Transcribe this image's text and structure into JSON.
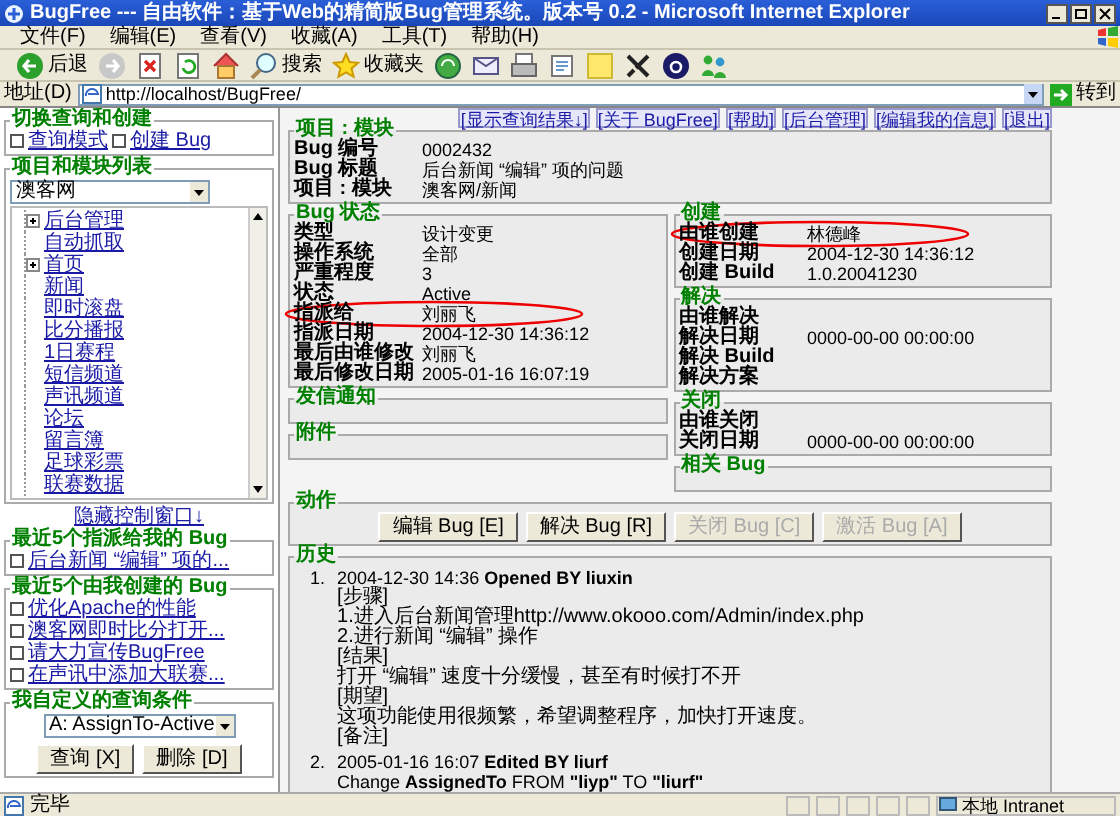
{
  "window": {
    "title": "BugFree --- 自由软件：基于Web的精简版Bug管理系统。版本号 0.2 - Microsoft Internet Explorer"
  },
  "menu": [
    "文件(F)",
    "编辑(E)",
    "查看(V)",
    "收藏(A)",
    "工具(T)",
    "帮助(H)"
  ],
  "toolbar": [
    {
      "kind": "back",
      "label": "后退"
    },
    {
      "kind": "forward"
    },
    {
      "kind": "stop"
    },
    {
      "kind": "refresh"
    },
    {
      "kind": "home"
    },
    {
      "kind": "search",
      "label": "搜索"
    },
    {
      "kind": "favorites",
      "label": "收藏夹"
    },
    {
      "kind": "media"
    },
    {
      "kind": "mail"
    },
    {
      "kind": "print"
    },
    {
      "kind": "edit"
    },
    {
      "kind": "note"
    },
    {
      "kind": "tool"
    },
    {
      "kind": "circle"
    },
    {
      "kind": "people"
    }
  ],
  "address": {
    "label": "地址(D)",
    "value": "http://localhost/BugFree/",
    "go": "转到"
  },
  "sidebar": {
    "switch": {
      "legend": "切换查询和创建",
      "options": [
        {
          "label": "查询模式",
          "checked": false
        },
        {
          "label": "创建 Bug",
          "checked": false
        }
      ]
    },
    "projects": {
      "legend": "项目和模块列表",
      "select": "澳客网",
      "items": [
        {
          "label": "后台管理",
          "has_children": true
        },
        {
          "label": "自动抓取",
          "has_children": false
        },
        {
          "label": "首页",
          "has_children": true
        },
        {
          "label": "新闻",
          "has_children": false
        },
        {
          "label": "即时滚盘",
          "has_children": false
        },
        {
          "label": "比分播报",
          "has_children": false
        },
        {
          "label": "1日赛程",
          "has_children": false
        },
        {
          "label": "短信频道",
          "has_children": false
        },
        {
          "label": "声讯频道",
          "has_children": false
        },
        {
          "label": "论坛",
          "has_children": false
        },
        {
          "label": "留言簿",
          "has_children": false
        },
        {
          "label": "足球彩票",
          "has_children": false
        },
        {
          "label": "联赛数据",
          "has_children": false
        }
      ]
    },
    "hide_link": "隐藏控制窗口↓",
    "assigned": {
      "legend": "最近5个指派给我的 Bug",
      "items": [
        {
          "label": "后台新闻 “编辑” 项的...",
          "checked": false
        }
      ]
    },
    "created": {
      "legend": "最近5个由我创建的 Bug",
      "items": [
        {
          "label": "优化Apache的性能",
          "checked": false
        },
        {
          "label": "澳客网即时比分打开...",
          "checked": false
        },
        {
          "label": "请大力宣传BugFree",
          "checked": false
        },
        {
          "label": "在声讯中添加大联赛...",
          "checked": false
        }
      ]
    },
    "queries": {
      "legend": "我自定义的查询条件",
      "select": "A: AssignTo-Active",
      "buttons": [
        "查询 [X]",
        "删除 [D]"
      ]
    }
  },
  "top_links": [
    "[显示查询结果↓]",
    "[关于 BugFree]",
    "[帮助]",
    "[后台管理]",
    "[编辑我的信息]",
    "[退出]"
  ],
  "bug": {
    "project": {
      "legend": "项目 : 模块",
      "fields": [
        {
          "label": "Bug 编号",
          "value": "0002432"
        },
        {
          "label": "Bug 标题",
          "value": "后台新闻 “编辑” 项的问题"
        },
        {
          "label": "项目 : 模块",
          "value": "澳客网/新闻"
        }
      ]
    },
    "status": {
      "legend": "Bug 状态",
      "fields": [
        {
          "label": "类型",
          "value": "设计变更"
        },
        {
          "label": "操作系统",
          "value": "全部"
        },
        {
          "label": "严重程度",
          "value": "3"
        },
        {
          "label": "状态",
          "value": "Active"
        },
        {
          "label": "指派给",
          "value": "刘丽飞",
          "circled": true
        },
        {
          "label": "指派日期",
          "value": "2004-12-30 14:36:12"
        },
        {
          "label": "最后由谁修改",
          "value": "刘丽飞"
        },
        {
          "label": "最后修改日期",
          "value": "2005-01-16 16:07:19"
        }
      ]
    },
    "notify": {
      "legend": "发信通知"
    },
    "attachments": {
      "legend": "附件"
    },
    "created": {
      "legend": "创建",
      "fields": [
        {
          "label": "由谁创建",
          "value": "林德峰",
          "circled": true
        },
        {
          "label": "创建日期",
          "value": "2004-12-30 14:36:12"
        },
        {
          "label": "创建 Build",
          "value": "1.0.20041230"
        }
      ]
    },
    "resolved": {
      "legend": "解决",
      "fields": [
        {
          "label": "由谁解决"
        },
        {
          "label": "解决日期",
          "value": "0000-00-00 00:00:00"
        },
        {
          "label": "解决 Build"
        },
        {
          "label": "解决方案"
        }
      ]
    },
    "closed": {
      "legend": "关闭",
      "fields": [
        {
          "label": "由谁关闭"
        },
        {
          "label": "关闭日期",
          "value": "0000-00-00 00:00:00"
        }
      ]
    },
    "related": {
      "legend": "相关 Bug"
    },
    "actions": {
      "legend": "动作",
      "buttons": [
        {
          "label": "编辑 Bug [E]",
          "disabled": false
        },
        {
          "label": "解决 Bug [R]",
          "disabled": false
        },
        {
          "label": "关闭 Bug [C]",
          "disabled": true
        },
        {
          "label": "激活 Bug [A]",
          "disabled": true
        }
      ]
    },
    "history": {
      "legend": "历史",
      "entries": [
        {
          "number": "1.",
          "header": "2004-12-30 14:36 **Opened BY liuxin**",
          "lines": [
            "[步骤]",
            "1.进入后台新闻管理http://www.okooo.com/Admin/index.php",
            "2.进行新闻 “编辑” 操作",
            "[结果]",
            "打开 “编辑” 速度十分缓慢，甚至有时候打不开",
            "[期望]",
            "这项功能使用很频繁，希望调整程序，加快打开速度。",
            "[备注]"
          ]
        },
        {
          "number": "2.",
          "header": "2005-01-16 16:07 **Edited BY liurf**",
          "lines": [
            "Change **AssignedTo** FROM **\"liyp\"** TO **\"liurf\"**"
          ]
        }
      ]
    }
  },
  "status_bar": {
    "text": "完毕",
    "zone": "本地 Intranet"
  }
}
